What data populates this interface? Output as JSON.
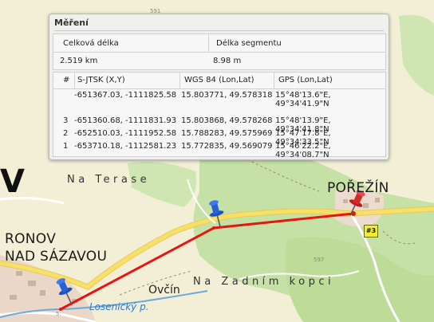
{
  "map": {
    "labels": {
      "frag_v": "V",
      "na_terase": "Na Terase",
      "porezin": "POŘEŽÍN",
      "ronov_line1": "RONOV",
      "ronov_line2": "NAD SÁZAVOU",
      "ovcin": "Ovčín",
      "na_zadnim_kopci": "Na Zadním kopci",
      "stream": "Losenický p."
    },
    "elevations": [
      "591",
      "597",
      "5."
    ],
    "marker_badge": "#3",
    "colors": {
      "route": "#e8140f",
      "road": "#f7e067",
      "forest": "#c6e1a5",
      "field": "#f3efd6",
      "town": "#ead7c8",
      "water": "#6aa9dc",
      "pin_blue": "#1f4fc4",
      "pin_red": "#d42a2a",
      "badge": "#f4ec2e"
    }
  },
  "panel": {
    "title": "Měření",
    "summary": {
      "total_label": "Celková délka",
      "segment_label": "Délka segmentu",
      "total_value": "2.519 km",
      "segment_value": "8.98 m"
    },
    "table": {
      "headers": [
        "#",
        "S-JTSK (X,Y)",
        "WGS 84 (Lon,Lat)",
        "GPS (Lon,Lat)"
      ],
      "rows": [
        {
          "num": "",
          "sjtsk": "-651367.03, -1111825.58",
          "wgs": "15.803771, 49.578318",
          "gps": "15°48'13.6\"E, 49°34'41.9\"N"
        },
        {
          "num": "3",
          "sjtsk": "-651360.68, -1111831.93",
          "wgs": "15.803868, 49.578268",
          "gps": "15°48'13.9\"E, 49°34'41.8\"N"
        },
        {
          "num": "2",
          "sjtsk": "-652510.03, -1111952.58",
          "wgs": "15.788283, 49.575969",
          "gps": "15°47'17.8\"E, 49°34'33.5\"N"
        },
        {
          "num": "1",
          "sjtsk": "-653710.18, -1112581.23",
          "wgs": "15.772835, 49.569079",
          "gps": "15°46'22.2\"E, 49°34'08.7\"N"
        }
      ]
    }
  }
}
